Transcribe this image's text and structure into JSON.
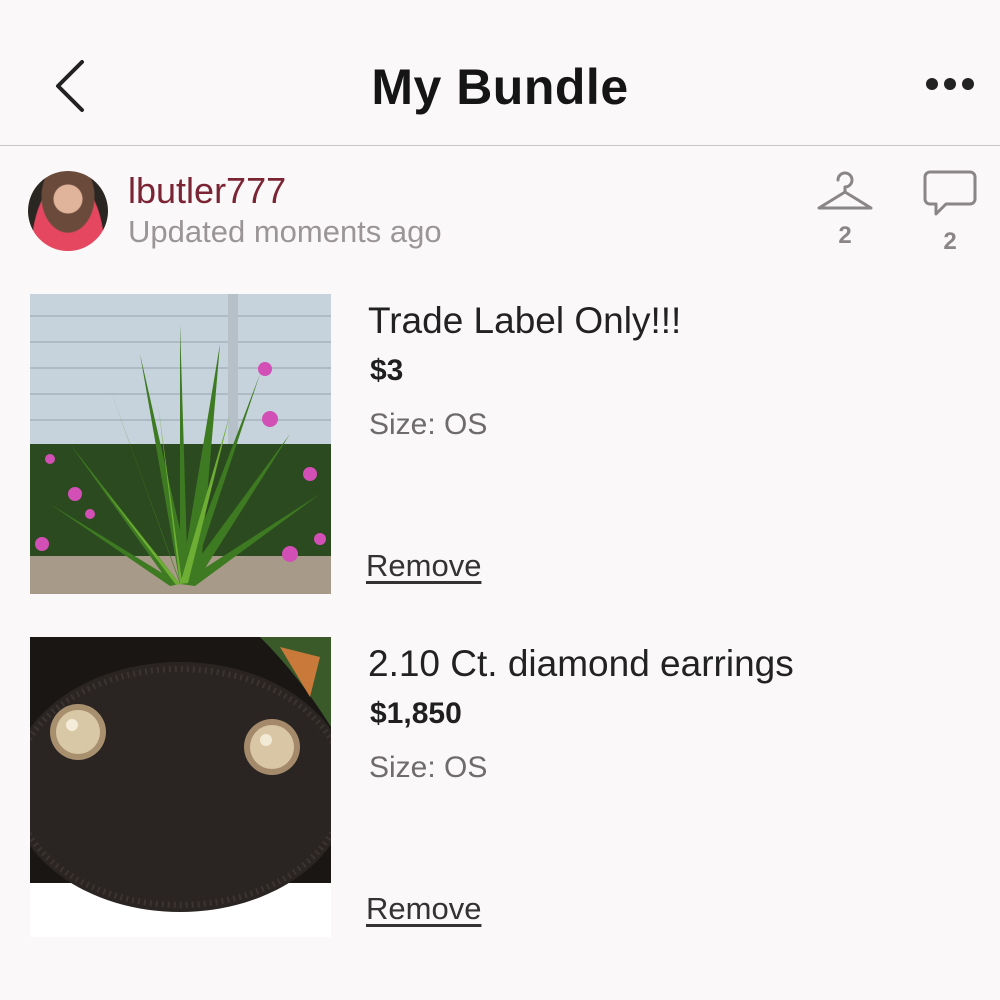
{
  "header": {
    "title": "My Bundle",
    "back_icon": "chevron-left-icon",
    "more_icon": "more-horizontal-icon"
  },
  "seller": {
    "username": "lbutler777",
    "updated": "Updated moments ago",
    "likes_count": "2",
    "comments_count": "2"
  },
  "items": [
    {
      "title": "Trade Label Only!!!",
      "price": "$3",
      "size": "Size: OS",
      "remove_label": "Remove"
    },
    {
      "title": "2.10 Ct. diamond earrings",
      "price": "$1,850",
      "size": "Size: OS",
      "remove_label": "Remove"
    }
  ],
  "colors": {
    "username": "#7a2434",
    "background": "#fbf8f9",
    "divider": "#c9c5c6"
  }
}
